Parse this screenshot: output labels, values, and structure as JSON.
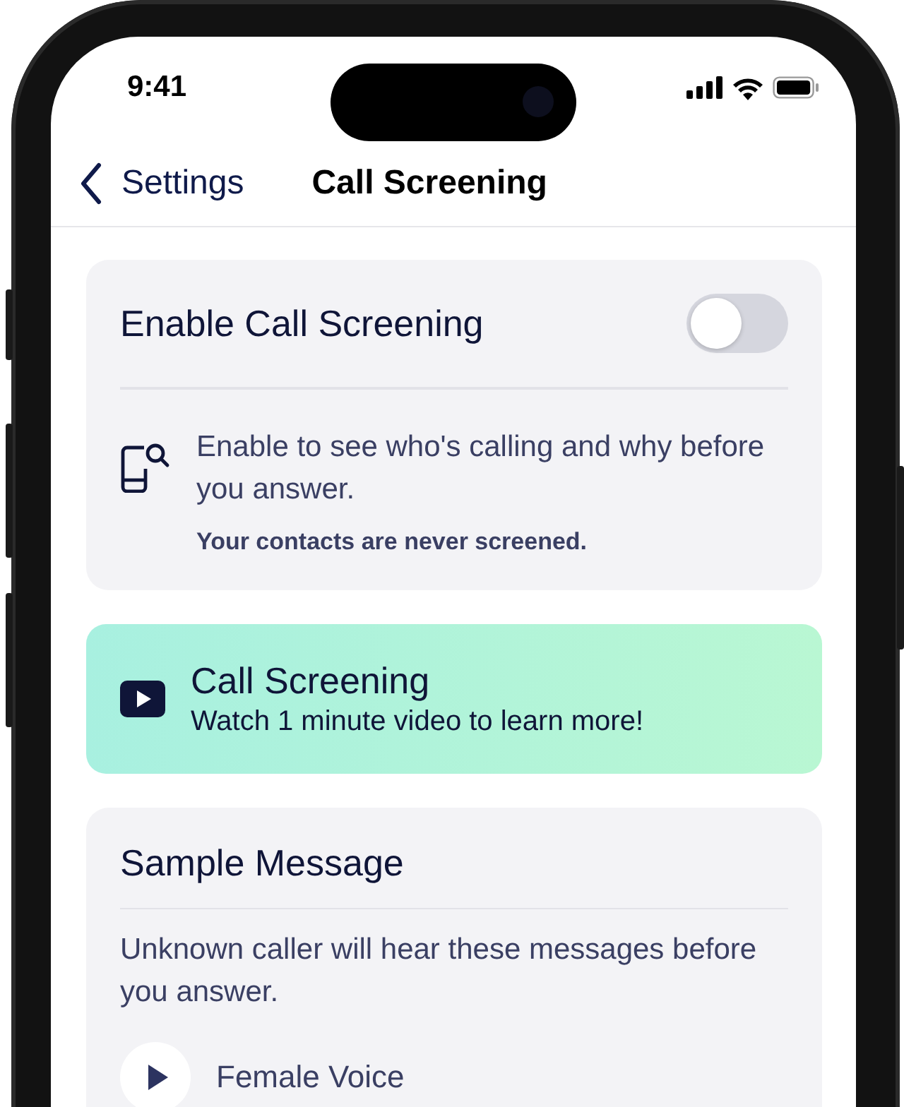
{
  "status_bar": {
    "time": "9:41"
  },
  "nav": {
    "back_label": "Settings",
    "title": "Call Screening"
  },
  "enable_card": {
    "title": "Enable Call Screening",
    "toggle": {
      "on": false
    },
    "description": "Enable to see who's calling and why before you answer.",
    "note": "Your contacts are never screened."
  },
  "promo": {
    "title": "Call Screening",
    "subtitle": "Watch 1 minute video to learn more!"
  },
  "sample_card": {
    "title": "Sample Message",
    "description": "Unknown caller will hear these messages before you answer.",
    "voices": [
      {
        "label": "Female Voice"
      }
    ]
  }
}
